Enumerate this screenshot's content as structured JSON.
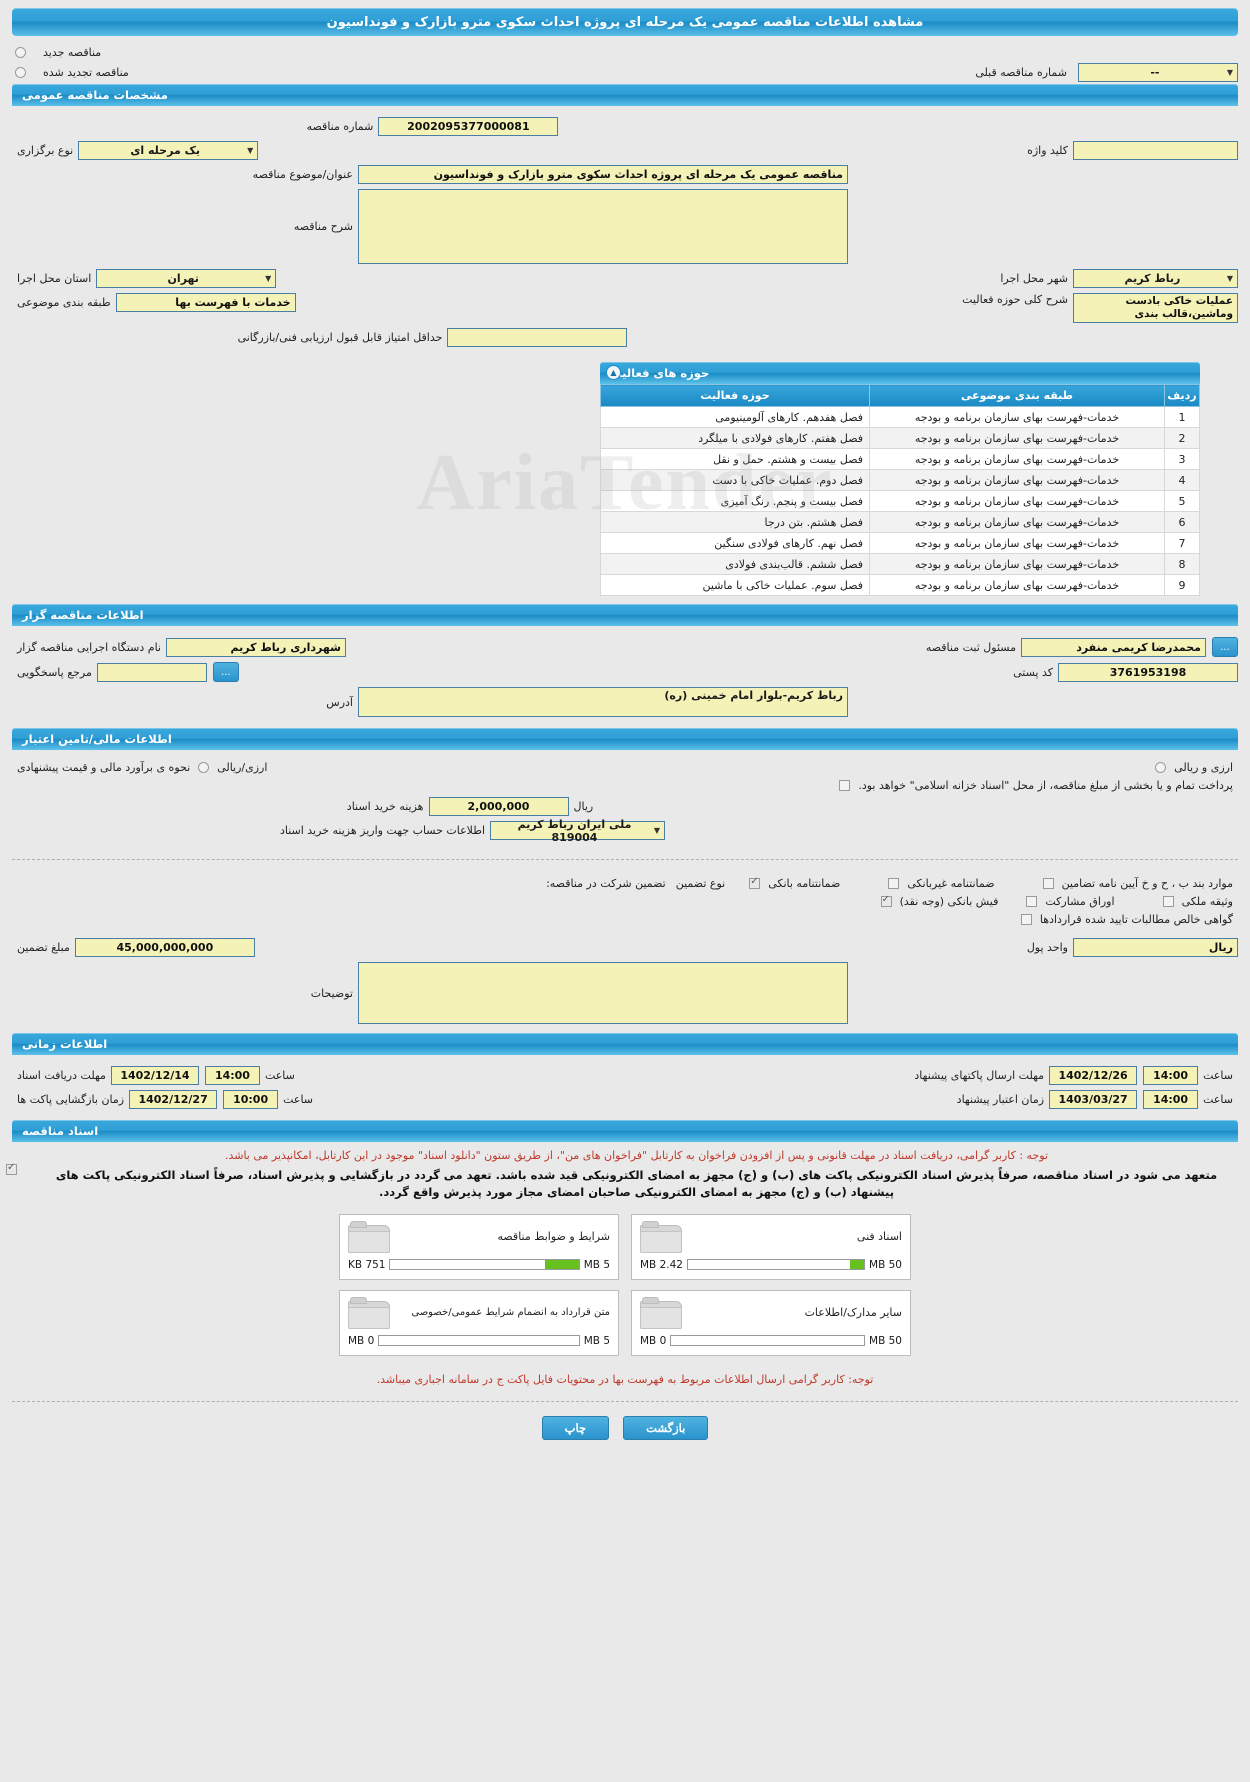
{
  "page_title": "مشاهده اطلاعات مناقصه عمومی یک مرحله ای پروژه احداث سکوی مترو بازارک و فونداسیون",
  "top": {
    "radio_new_label": "مناقصه جدید",
    "radio_renewed_label": "مناقصه تجدید شده",
    "prev_number_label": "شماره مناقصه قبلی",
    "prev_number_value": "--"
  },
  "general": {
    "section_title": "مشخصات مناقصه عمومی",
    "tender_no_label": "شماره مناقصه",
    "tender_no_value": "2002095377000081",
    "hold_type_label": "نوع برگزاری",
    "hold_type_value": "یک مرحله ای",
    "keyword_label": "کلید واژه",
    "keyword_value": "",
    "subject_label": "عنوان/موضوع مناقصه",
    "subject_value": "مناقصه عمومی یک مرحله ای پروژه احداث سکوی مترو بازارک و فونداسیون",
    "description_label": "شرح مناقصه",
    "description_value": "",
    "province_label": "استان محل اجرا",
    "province_value": "تهران",
    "city_label": "شهر محل اجرا",
    "city_value": "رباط کریم",
    "category_label": "طبقه بندی موضوعی",
    "category_value": "خدمات با فهرست بها",
    "activity_summary_label": "شرح کلی حوزه فعالیت",
    "activity_summary_value": "عملیات خاکی بادست وماشین،قالب بندی",
    "min_score_label": "حداقل امتیاز قابل قبول ارزیابی فنی/بازرگانی",
    "min_score_value": ""
  },
  "activities": {
    "section_title": "حوزه های فعالیت",
    "columns": [
      "ردیف",
      "طبقه بندی موضوعی",
      "حوزه فعالیت"
    ],
    "rows": [
      {
        "no": "1",
        "category": "خدمات-فهرست بهای سازمان برنامه و بودجه",
        "area": "فصل هفدهم. کارهای آلومینیومی"
      },
      {
        "no": "2",
        "category": "خدمات-فهرست بهای سازمان برنامه و بودجه",
        "area": "فصل هفتم. کارهای فولادی با میلگرد"
      },
      {
        "no": "3",
        "category": "خدمات-فهرست بهای سازمان برنامه و بودجه",
        "area": "فصل بیست و هشتم. حمل و نقل"
      },
      {
        "no": "4",
        "category": "خدمات-فهرست بهای سازمان برنامه و بودجه",
        "area": "فصل دوم. عملیات خاکی با دست"
      },
      {
        "no": "5",
        "category": "خدمات-فهرست بهای سازمان برنامه و بودجه",
        "area": "فصل بیست و پنجم. رنگ آمیزی"
      },
      {
        "no": "6",
        "category": "خدمات-فهرست بهای سازمان برنامه و بودجه",
        "area": "فصل هشتم. بتن درجا"
      },
      {
        "no": "7",
        "category": "خدمات-فهرست بهای سازمان برنامه و بودجه",
        "area": "فصل نهم. کارهای فولادی سنگین"
      },
      {
        "no": "8",
        "category": "خدمات-فهرست بهای سازمان برنامه و بودجه",
        "area": "فصل ششم. قالب‌بندی فولادی"
      },
      {
        "no": "9",
        "category": "خدمات-فهرست بهای سازمان برنامه و بودجه",
        "area": "فصل سوم. عملیات خاکی با ماشین"
      }
    ]
  },
  "organizer": {
    "section_title": "اطلاعات مناقصه گزار",
    "agency_label": "نام دستگاه اجرایی مناقصه گزار",
    "agency_value": "شهرداری رباط کریم",
    "registrar_label": "مسئول ثبت مناقصه",
    "registrar_value": "محمدرضا کریمی منفرد",
    "contact_label": "مرجع پاسخگویی",
    "contact_value": "",
    "postal_label": "کد پستی",
    "postal_value": "3761953198",
    "address_label": "آدرس",
    "address_value": "رباط کریم-بلوار امام خمینی (ره)",
    "picker_button": "..."
  },
  "finance": {
    "section_title": "اطلاعات مالی/تامین اعتبار",
    "estimate_label": "نحوه ی برآورد مالی و قیمت پیشنهادی",
    "option_rial": "ارزی/ریالی",
    "option_both": "ارزی و ریالی",
    "treasury_note": "پرداخت تمام و یا بخشی از مبلغ مناقصه، از محل \"اسناد خزانه اسلامی\" خواهد بود.",
    "doc_cost_label": "هزینه خرید اسناد",
    "doc_cost_value": "2,000,000",
    "doc_cost_unit": "ریال",
    "account_label": "اطلاعات حساب جهت واریز هزینه خرید اسناد",
    "account_value": "ملی ایران رباط کریم 819004"
  },
  "guarantee": {
    "participation_label": "تضمین شرکت در مناقصه:",
    "type_label": "نوع تضمین",
    "options": [
      {
        "label": "ضمانتنامه بانکی",
        "checked": true
      },
      {
        "label": "ضمانتنامه غیربانکی",
        "checked": false
      },
      {
        "label": "موارد بند ب ، ح و خ آیین نامه تضامین",
        "checked": false
      },
      {
        "label": "فیش بانکی (وجه نقد)",
        "checked": true
      },
      {
        "label": "اوراق مشارکت",
        "checked": false
      },
      {
        "label": "وثیقه ملکی",
        "checked": false
      },
      {
        "label": "گواهی خالص مطالبات تایید شده قراردادها",
        "checked": false
      }
    ],
    "amount_label": "مبلغ تضمین",
    "amount_value": "45,000,000,000",
    "currency_label": "واحد پول",
    "currency_value": "ریال",
    "notes_label": "توضیحات",
    "notes_value": ""
  },
  "timing": {
    "section_title": "اطلاعات زمانی",
    "doc_receive_label": "مهلت دریافت اسناد",
    "doc_receive_date": "1402/12/14",
    "doc_receive_time_label": "ساعت",
    "doc_receive_time": "14:00",
    "proposal_send_label": "مهلت ارسال پاکتهای پیشنهاد",
    "proposal_send_date": "1402/12/26",
    "proposal_send_time_label": "ساعت",
    "proposal_send_time": "14:00",
    "opening_label": "زمان بازگشایی پاکت ها",
    "opening_date": "1402/12/27",
    "opening_time_label": "ساعت",
    "opening_time": "10:00",
    "validity_label": "زمان اعتبار پیشنهاد",
    "validity_date": "1403/03/27",
    "validity_time_label": "ساعت",
    "validity_time": "14:00"
  },
  "documents": {
    "section_title": "اسناد مناقصه",
    "note_red": "توجه : کاربر گرامی، دریافت اسناد در مهلت قانونی و پس از افزودن فراخوان به کارتابل \"فراخوان های من\"، از طریق ستون \"دانلود اسناد\" موجود در این کارتابل، امکانپذیر می باشد.",
    "note_commit": "متعهد می شود در اسناد مناقصه، صرفاً پذیرش اسناد الکترونیکی پاکت های (ب) و (ج) مجهز به امضای الکترونیکی قید شده باشد. تعهد می گردد در بازگشایی و پذیرش اسناد، صرفاً اسناد الکترونیکی پاکت های پیشنهاد (ب) و (ج) مجهز به امضای الکترونیکی صاحبان امضای مجاز مورد پذیرش واقع گردد.",
    "boxes": [
      {
        "name": "شرایط و ضوابط مناقصه",
        "size": "751 KB",
        "max": "5 MB",
        "fill": 18
      },
      {
        "name": "اسناد فنی",
        "size": "2.42 MB",
        "max": "50 MB",
        "fill": 8
      },
      {
        "name": "متن قرارداد به انضمام شرایط عمومی/خصوصی",
        "size": "0 MB",
        "max": "5 MB",
        "fill": 0
      },
      {
        "name": "سایر مدارک/اطلاعات",
        "size": "0 MB",
        "max": "50 MB",
        "fill": 0
      }
    ],
    "footer_note": "توجه: کاربر گرامی ارسال اطلاعات مربوط به فهرست بها در محتویات فایل پاکت ج در سامانه اجباری میباشد."
  },
  "footer": {
    "print_label": "چاپ",
    "back_label": "بازگشت"
  },
  "colors": {
    "header_blue": "#1c8cc6",
    "field_yellow": "#f5f2b8",
    "field_border": "#4a7fa5",
    "red_note": "#c0392b"
  }
}
